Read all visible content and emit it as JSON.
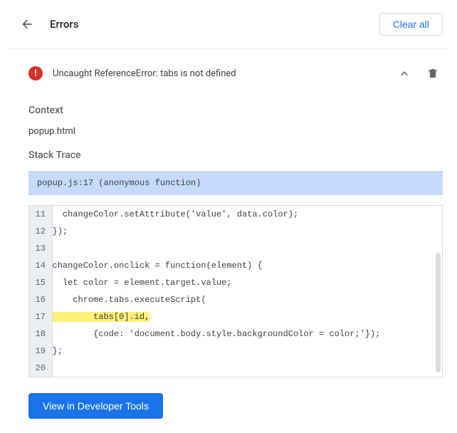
{
  "header": {
    "title": "Errors",
    "clear_all": "Clear all"
  },
  "error": {
    "message": "Uncaught ReferenceError: tabs is not defined"
  },
  "context": {
    "label": "Context",
    "value": "popup.html"
  },
  "trace": {
    "label": "Stack Trace",
    "line": "popup.js:17 (anonymous function)"
  },
  "code": {
    "lines": [
      {
        "n": "11",
        "text": "  changeColor.setAttribute('value', data.color);",
        "hl": false
      },
      {
        "n": "12",
        "text": "});",
        "hl": false
      },
      {
        "n": "13",
        "text": "",
        "hl": false
      },
      {
        "n": "14",
        "text": "changeColor.onclick = function(element) {",
        "hl": false
      },
      {
        "n": "15",
        "text": "  let color = element.target.value;",
        "hl": false
      },
      {
        "n": "16",
        "text": "    chrome.tabs.executeScript(",
        "hl": false
      },
      {
        "n": "17",
        "text": "        tabs[0].id,",
        "hl": true
      },
      {
        "n": "18",
        "text": "        {code: 'document.body.style.backgroundColor = color;'});",
        "hl": false
      },
      {
        "n": "19",
        "text": "};",
        "hl": false
      },
      {
        "n": "20",
        "text": "",
        "hl": false
      }
    ]
  },
  "footer": {
    "view_btn": "View in Developer Tools"
  }
}
